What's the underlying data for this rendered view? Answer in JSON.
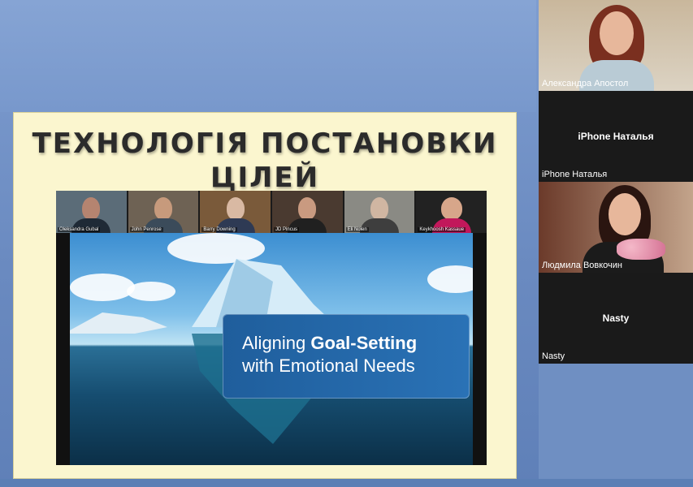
{
  "slide": {
    "title_line1": "ТЕХНОЛОГІЯ ПОСТАНОВКИ",
    "title_line2": "ЦІЛЕЙ",
    "gallery": [
      {
        "name": "Oleksandra Gubal"
      },
      {
        "name": "John Penrose"
      },
      {
        "name": "Barry Downing"
      },
      {
        "name": "JD Pincus"
      },
      {
        "name": "Eli Nolen"
      },
      {
        "name": "Keykhoosh Kassaue"
      }
    ],
    "cta_line1_prefix": "Aligning ",
    "cta_line1_bold": "Goal-Setting",
    "cta_line2": "with Emotional Needs"
  },
  "participants": [
    {
      "name": "Александра Апостол",
      "video": true
    },
    {
      "name": "iPhone Наталья",
      "center_label": "iPhone Наталья",
      "video": false
    },
    {
      "name": "Людмила Вовкочин",
      "video": true
    },
    {
      "name": "Nasty",
      "center_label": "Nasty",
      "video": false
    }
  ],
  "colors": {
    "background": "#6f8fc2",
    "slide_bg": "#fbf6cf",
    "cta_blue": "#1f5e9c"
  }
}
